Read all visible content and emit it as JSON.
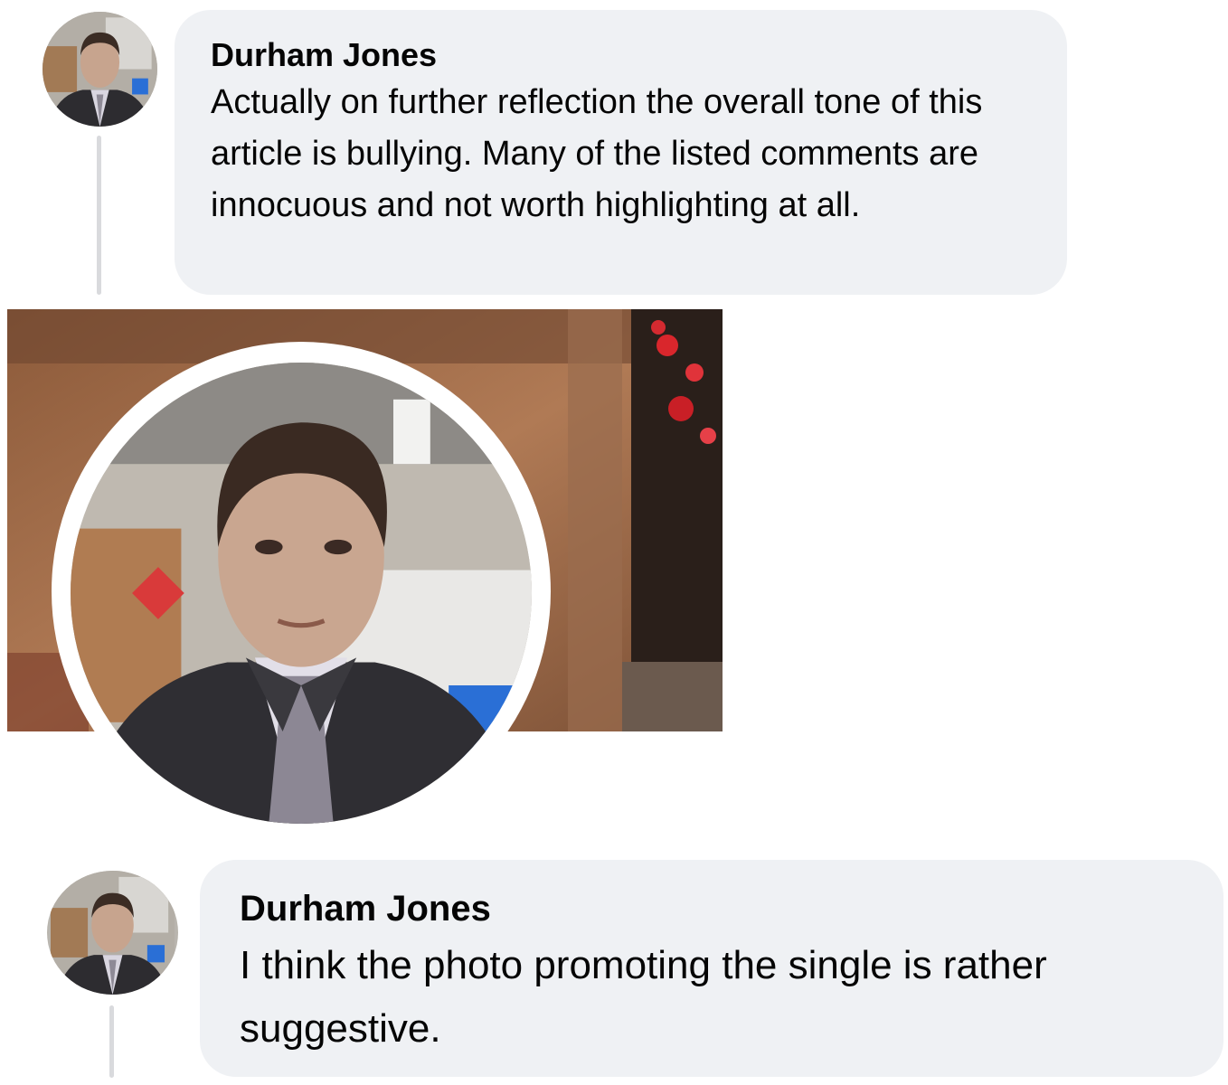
{
  "comments": [
    {
      "author": "Durham Jones",
      "text": "Actually on further reflection the overall tone of this article is bullying. Many of the listed comments are innocuous and not worth highlighting at all.",
      "avatar_icon": "profile-photo"
    },
    {
      "author": "Durham Jones",
      "text": "I think the photo promoting the single is rather suggestive.",
      "avatar_icon": "profile-photo"
    }
  ],
  "shared_image": {
    "icon": "profile-cover-photo"
  },
  "colors": {
    "bubble": "#eff1f4",
    "thread_line": "#d9dadd",
    "text": "#050505"
  }
}
